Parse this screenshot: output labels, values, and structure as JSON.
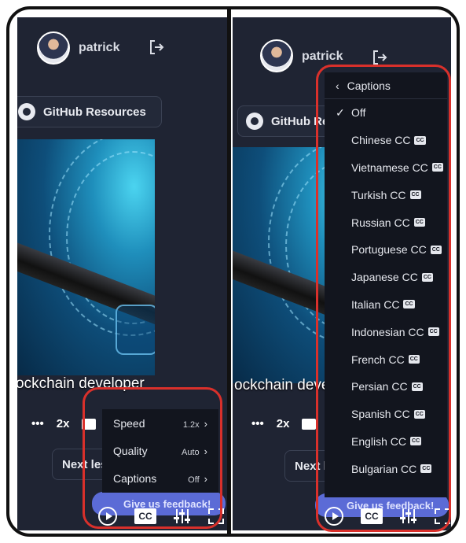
{
  "header": {
    "username": "patrick"
  },
  "resources": {
    "github_label": "GitHub Resources"
  },
  "video": {
    "caption_text": "ockchain developer"
  },
  "player": {
    "more_label": "•••",
    "speed_short": "2x",
    "cc_label": "CC"
  },
  "lesson": {
    "next_label": "Next lesson",
    "next_arrow": "→"
  },
  "feedback": {
    "label": "Give us feedback!"
  },
  "settings_menu": {
    "items": [
      {
        "label": "Speed",
        "value": "1.2x"
      },
      {
        "label": "Quality",
        "value": "Auto"
      },
      {
        "label": "Captions",
        "value": "Off"
      }
    ]
  },
  "captions_menu": {
    "title": "Captions",
    "selected": "Off",
    "badge": "CC",
    "items": [
      "Off",
      "Chinese CC",
      "Vietnamese CC",
      "Turkish CC",
      "Russian CC",
      "Portuguese CC",
      "Japanese CC",
      "Italian CC",
      "Indonesian CC",
      "French CC",
      "Persian CC",
      "Spanish CC",
      "English CC",
      "Bulgarian CC"
    ]
  },
  "colors": {
    "highlight": "#d9302b",
    "panel_bg": "#1f2433",
    "menu_bg": "#12151e",
    "accent": "#5b6bd6"
  },
  "icons": [
    "user-avatar",
    "logout-icon",
    "github-icon",
    "play-icon",
    "cc-icon",
    "equalizer-icon",
    "fullscreen-icon",
    "chevron-right-icon",
    "chevron-left-icon",
    "check-icon"
  ]
}
